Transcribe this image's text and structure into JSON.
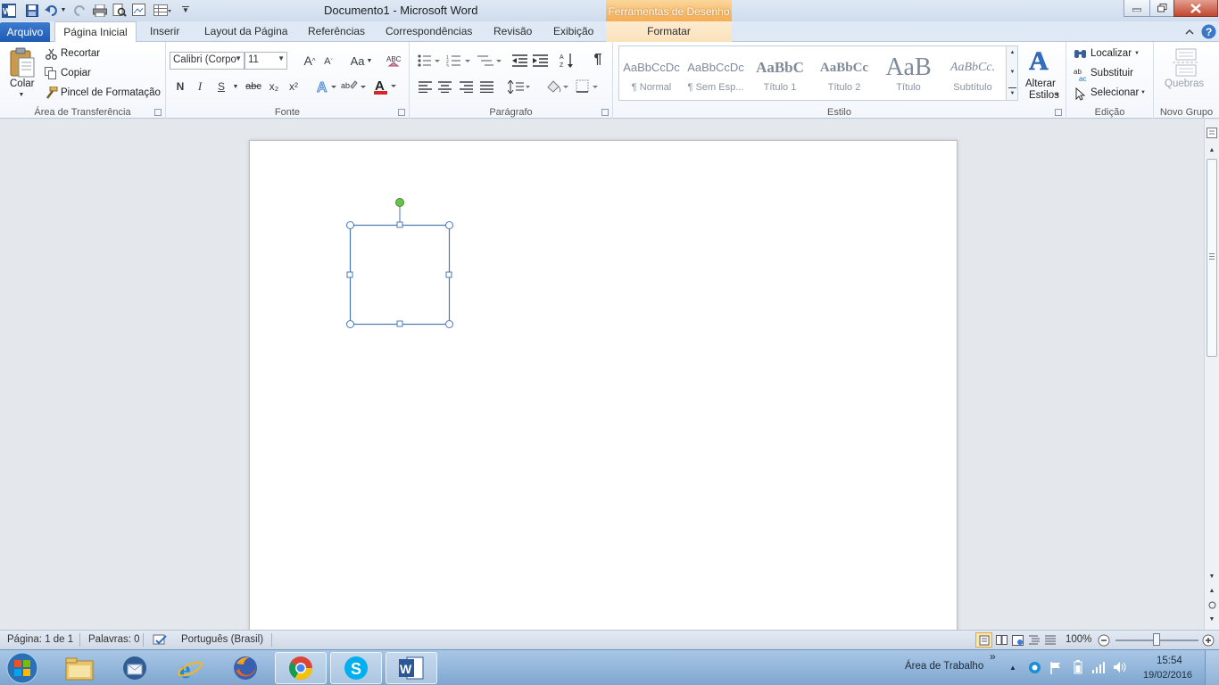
{
  "window": {
    "document_title": "Documento1  -  Microsoft Word",
    "context_tool": "Ferramentas de Desenho"
  },
  "tabs": {
    "file": "Arquivo",
    "items": [
      "Página Inicial",
      "Inserir",
      "Layout da Página",
      "Referências",
      "Correspondências",
      "Revisão",
      "Exibição"
    ],
    "contextual": "Formatar"
  },
  "ribbon": {
    "clipboard": {
      "paste": "Colar",
      "cut": "Recortar",
      "copy": "Copiar",
      "format_painter": "Pincel de Formatação",
      "label": "Área de Transferência"
    },
    "font": {
      "family": "Calibri (Corpo",
      "size": "11",
      "case_btn": "Aa",
      "bold": "N",
      "italic": "I",
      "underline": "S",
      "strike": "abc",
      "subscript": "x₂",
      "superscript": "x²",
      "label": "Fonte"
    },
    "paragraph": {
      "label": "Parágrafo",
      "pilcrow": "¶"
    },
    "styles": {
      "items": [
        {
          "sample": "AaBbCcDc",
          "name": "¶ Normal"
        },
        {
          "sample": "AaBbCcDc",
          "name": "¶ Sem Esp..."
        },
        {
          "sample": "AaBbC",
          "name": "Título 1"
        },
        {
          "sample": "AaBbCc",
          "name": "Título 2"
        },
        {
          "sample": "AaB",
          "name": "Título"
        },
        {
          "sample": "AaBbCc.",
          "name": "Subtítulo"
        }
      ],
      "change_line1": "Alterar",
      "change_line2": "Estilos",
      "label": "Estilo"
    },
    "editing": {
      "find": "Localizar",
      "replace": "Substituir",
      "select": "Selecionar",
      "label": "Edição"
    },
    "new_group": {
      "breaks": "Quebras",
      "label": "Novo Grupo"
    }
  },
  "statusbar": {
    "page": "Página: 1 de 1",
    "words": "Palavras: 0",
    "language": "Português (Brasil)",
    "zoom": "100%"
  },
  "taskbar": {
    "desktop_label": "Área de Trabalho",
    "time": "15:54",
    "date": "19/02/2016",
    "overflow": "»"
  },
  "colors": {
    "file_tab": "#2a66bf",
    "context_tab": "#f3a94d",
    "shape_handle": "#4a78b5",
    "rotate_handle": "#6cc24a"
  }
}
